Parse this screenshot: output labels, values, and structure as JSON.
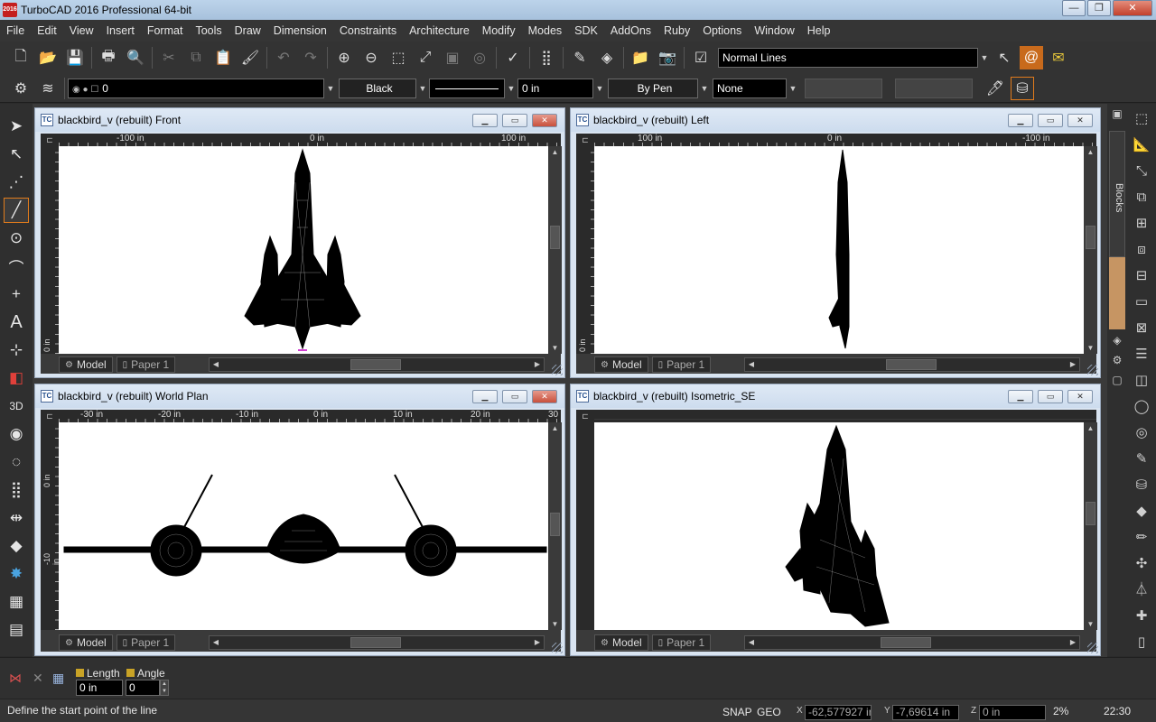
{
  "app": {
    "title": "TurboCAD 2016 Professional 64-bit",
    "icon_text": "2016"
  },
  "menu": [
    "File",
    "Edit",
    "View",
    "Insert",
    "Format",
    "Tools",
    "Draw",
    "Dimension",
    "Constraints",
    "Architecture",
    "Modify",
    "Modes",
    "SDK",
    "AddOns",
    "Ruby",
    "Options",
    "Window",
    "Help"
  ],
  "toolbar1": {
    "line_style": "Normal Lines"
  },
  "toolbar2": {
    "layer": "0",
    "color": "Black",
    "width": "0 in",
    "pen": "By Pen",
    "fill": "None"
  },
  "right_palette": {
    "blocks_label": "Blocks"
  },
  "windows": {
    "front": {
      "title": "blackbird_v (rebuilt) Front",
      "ruler": [
        "-100 in",
        "0 in",
        "100 in"
      ],
      "vruler": "0 in"
    },
    "left": {
      "title": "blackbird_v (rebuilt) Left",
      "ruler": [
        "100 in",
        "0 in",
        "-100 in"
      ],
      "vruler": "0 in"
    },
    "plan": {
      "title": "blackbird_v (rebuilt) World Plan",
      "ruler": [
        "-30 in",
        "-20 in",
        "-10 in",
        "0 in",
        "10 in",
        "20 in",
        "30"
      ],
      "vruler": [
        "0 in",
        "-10 in"
      ]
    },
    "iso": {
      "title": "blackbird_v (rebuilt) Isometric_SE"
    },
    "tabs": {
      "model": "Model",
      "paper": "Paper 1"
    }
  },
  "inputbar": {
    "length_label": "Length",
    "length_value": "0 in",
    "angle_label": "Angle",
    "angle_value": "0"
  },
  "status": {
    "prompt": "Define the start point of the line",
    "snap": "SNAP",
    "geo": "GEO",
    "x": "-62,577927 in",
    "y": "-7,69614 in",
    "z": "0 in",
    "zoom": "2%",
    "time": "22:30"
  }
}
